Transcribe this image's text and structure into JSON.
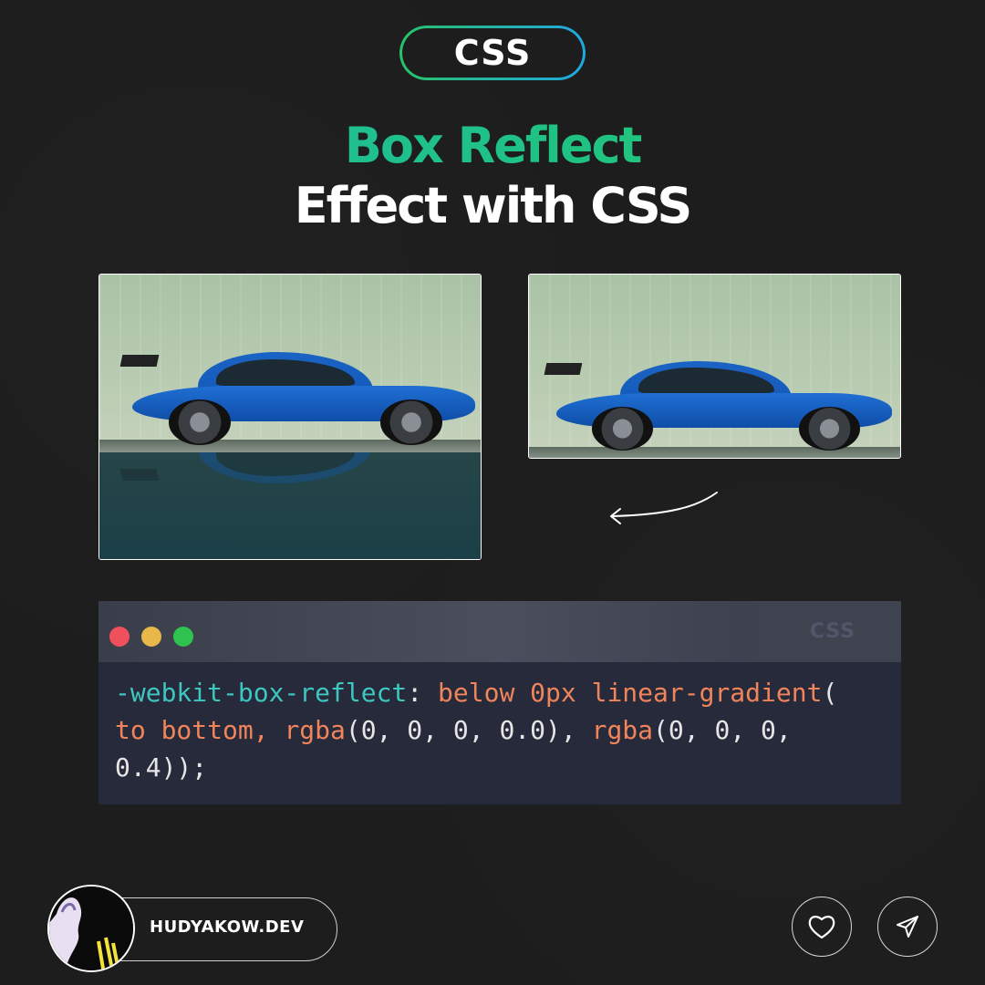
{
  "tag": {
    "label": "CSS"
  },
  "title": {
    "line1": "Box Reflect",
    "line2": "Effect with CSS"
  },
  "colors": {
    "background": "#1d1d1d",
    "accent_green": "#20c96b",
    "accent_teal": "#1fb9a3",
    "accent_blue": "#1fa7e0",
    "code_bg": "#262a3a",
    "code_property": "#3ec7c0",
    "code_value": "#f0845a",
    "dot_red": "#f0505b",
    "dot_yellow": "#e8b84a",
    "dot_green": "#2ec24f"
  },
  "images": {
    "left": {
      "description": "blue-car-with-reflection"
    },
    "right": {
      "description": "blue-car-original"
    }
  },
  "code_window": {
    "language_tab": "CSS",
    "line1": {
      "property": "-webkit-box-reflect",
      "colon": ": ",
      "value": "below 0px linear-gradient",
      "punc": "("
    },
    "line2": {
      "v1": "to bottom, ",
      "v2": "rgba",
      "p1": "(0, 0, 0, 0.0), ",
      "v3": "rgba",
      "p2": "(0, 0, 0,"
    },
    "line3": {
      "p1": "0.4));"
    }
  },
  "footer": {
    "author": "HUDYAKOW.DEV",
    "like_icon": "heart-icon",
    "share_icon": "send-icon"
  }
}
